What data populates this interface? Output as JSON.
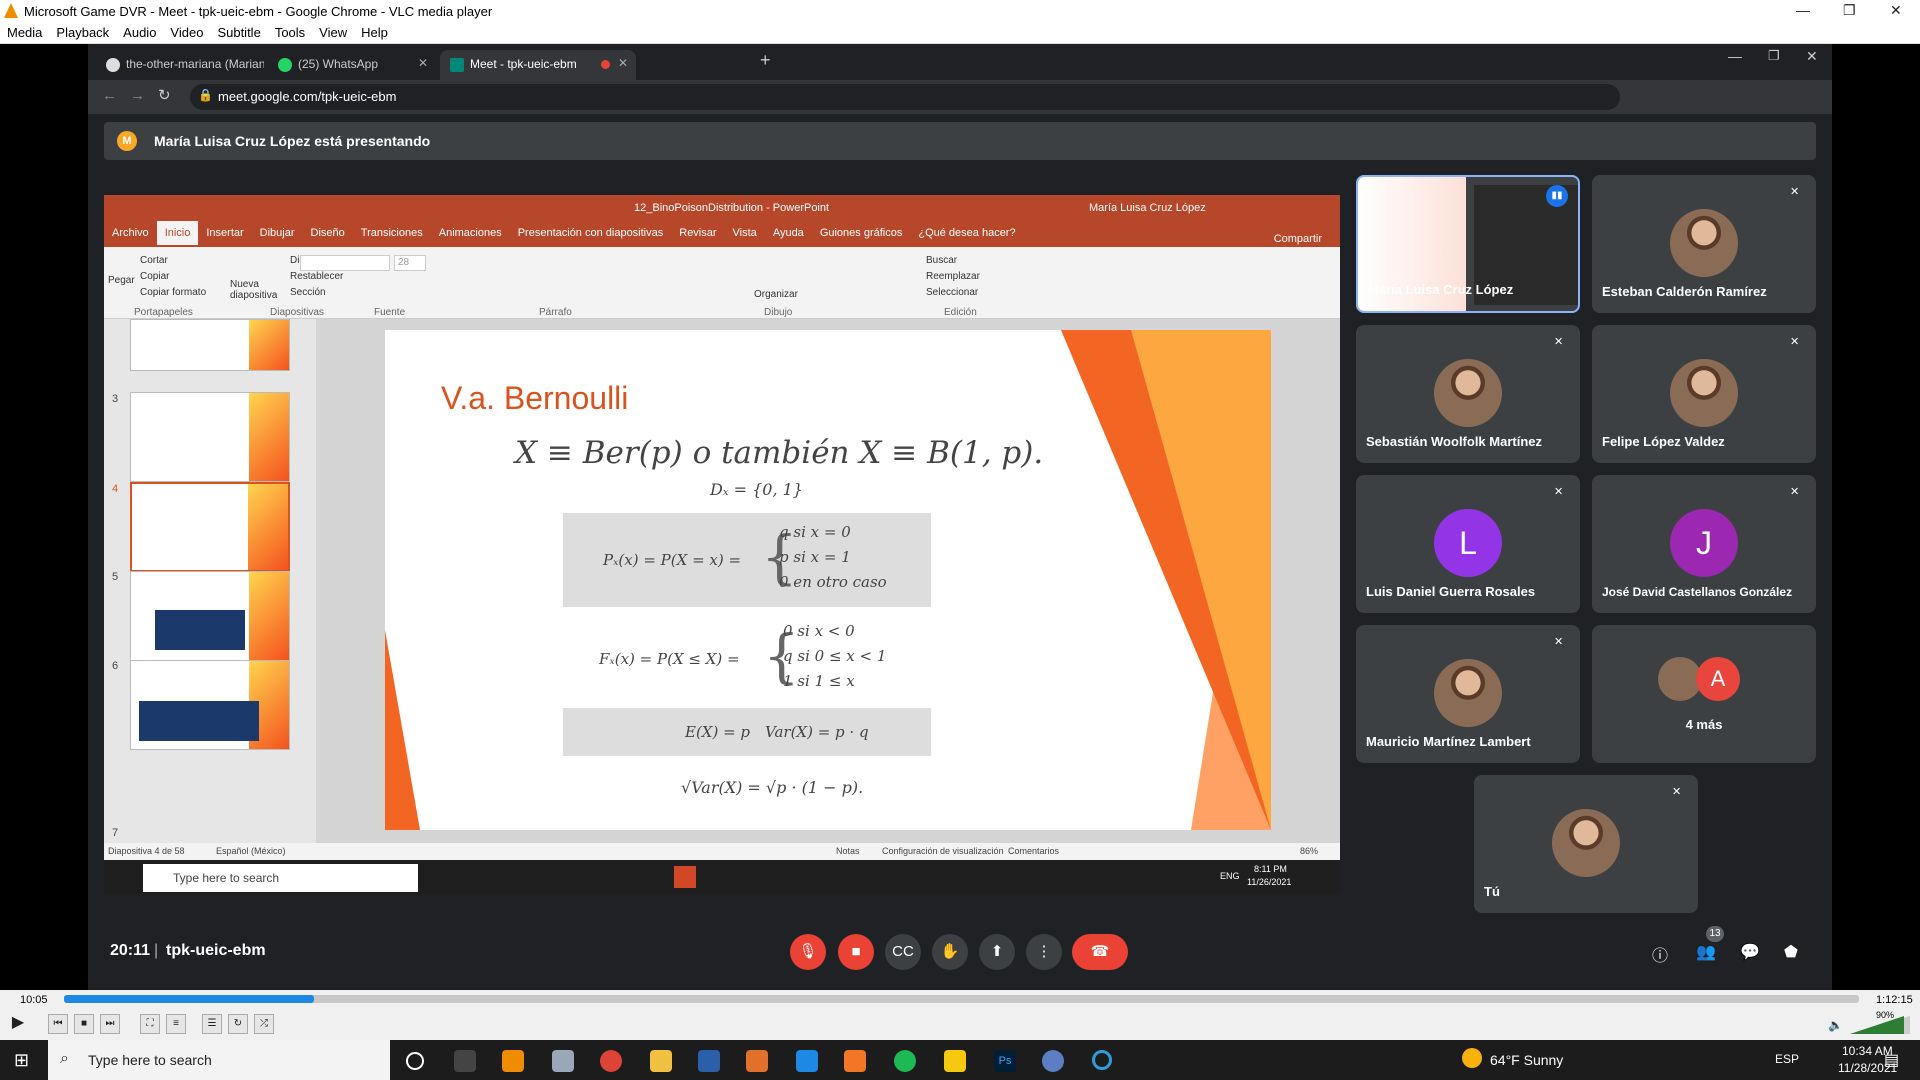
{
  "window": {
    "title": "Microsoft Game DVR - Meet - tpk-ueic-ebm - Google Chrome - VLC media player"
  },
  "menu": [
    "Media",
    "Playback",
    "Audio",
    "Video",
    "Subtitle",
    "Tools",
    "View",
    "Help"
  ],
  "chrome": {
    "tabs": [
      {
        "label": "the-other-mariana (Mariana Ával"
      },
      {
        "label": "(25) WhatsApp"
      },
      {
        "label": "Meet - tpk-ueic-ebm"
      }
    ],
    "url": "meet.google.com/tpk-ueic-ebm"
  },
  "meet": {
    "presenting_initial": "M",
    "presenting": "María Luisa Cruz López está presentando",
    "time": "20:11",
    "sep": "|",
    "code": "tpk-ueic-ebm",
    "participant_count": "13"
  },
  "ppt": {
    "title": "12_BinoPoisonDistribution - PowerPoint",
    "user": "María Luisa Cruz López",
    "tabs": [
      "Archivo",
      "Inicio",
      "Insertar",
      "Dibujar",
      "Diseño",
      "Transiciones",
      "Animaciones",
      "Presentación con diapositivas",
      "Revisar",
      "Vista",
      "Ayuda",
      "Guiones gráficos",
      "¿Qué desea hacer?"
    ],
    "share": "Compartir",
    "ribbon": {
      "cortar": "Cortar",
      "copiar": "Copiar",
      "copiar_formato": "Copiar formato",
      "pegar": "Pegar",
      "portapapeles": "Portapapeles",
      "nueva": "Nueva diapositiva",
      "diseno": "Diseño",
      "restablecer": "Restablecer",
      "seccion": "Sección",
      "diapositivas": "Diapositivas",
      "fuente": "Fuente",
      "parrafo": "Párrafo",
      "organizar": "Organizar",
      "dibujo": "Dibujo",
      "buscar": "Buscar",
      "reemplazar": "Reemplazar",
      "seleccionar": "Seleccionar",
      "edicion": "Edición",
      "font_size": "28"
    },
    "thumb_nums": [
      "3",
      "4",
      "5",
      "6",
      "7"
    ],
    "status": {
      "slide": "Diapositiva 4 de 58",
      "lang": "Español (México)",
      "notas": "Notas",
      "config": "Configuración de visualización",
      "comentarios": "Comentarios",
      "zoom": "86%"
    },
    "taskbar": {
      "search": "Type here to search",
      "lang": "ENG",
      "time": "8:11 PM",
      "date": "11/26/2021"
    }
  },
  "slide": {
    "title": "V.a. Bernoulli",
    "eq1": "X ≡ Ber(p) o también X ≡ B(1, p).",
    "eq2": "Dₓ = {0, 1}",
    "pmf_lhs": "Pₓ(x) = P(X = x) =",
    "pmf_rows": [
      "q    si x = 0",
      "p    si x = 1",
      "0    en otro caso"
    ],
    "cdf_lhs": "Fₓ(x) = P(X ≤ X) =",
    "cdf_rows": [
      "0    si x < 0",
      "q    si 0 ≤ x < 1",
      "1    si 1 ≤ x"
    ],
    "ex": "E(X) = p",
    "var": "Var(X) = p · q",
    "sd": "√Var(X) = √p · (1 − p)."
  },
  "participants": [
    {
      "name": "María Luisa Cruz López",
      "speaking": true
    },
    {
      "name": "Esteban Calderón Ramírez",
      "muted": true
    },
    {
      "name": "Sebastián Woolfolk Martínez",
      "muted": true
    },
    {
      "name": "Felipe López Valdez",
      "muted": true
    },
    {
      "name": "Luis Daniel Guerra Rosales",
      "initial": "L",
      "color": "#9334e6",
      "muted": true
    },
    {
      "name": "José David Castellanos González",
      "initial": "J",
      "color": "#9c27b0",
      "muted": true
    },
    {
      "name": "Mauricio Martínez Lambert",
      "muted": true
    },
    {
      "name": "4 más",
      "extra_initial": "A",
      "color": "#e8453c"
    },
    {
      "name": "Tú",
      "muted": true
    }
  ],
  "vlc": {
    "elapsed": "10:05",
    "total": "1:12:15",
    "progress": 0.139,
    "volume": "90%"
  },
  "taskbar": {
    "search": "Type here to search",
    "weather": "64°F  Sunny",
    "lang": "ESP",
    "time": "10:34 AM",
    "date": "11/28/2021"
  },
  "colors": {
    "accent_red": "#ea4335",
    "ppt": "#b7472a",
    "meet_bg": "#202124"
  }
}
